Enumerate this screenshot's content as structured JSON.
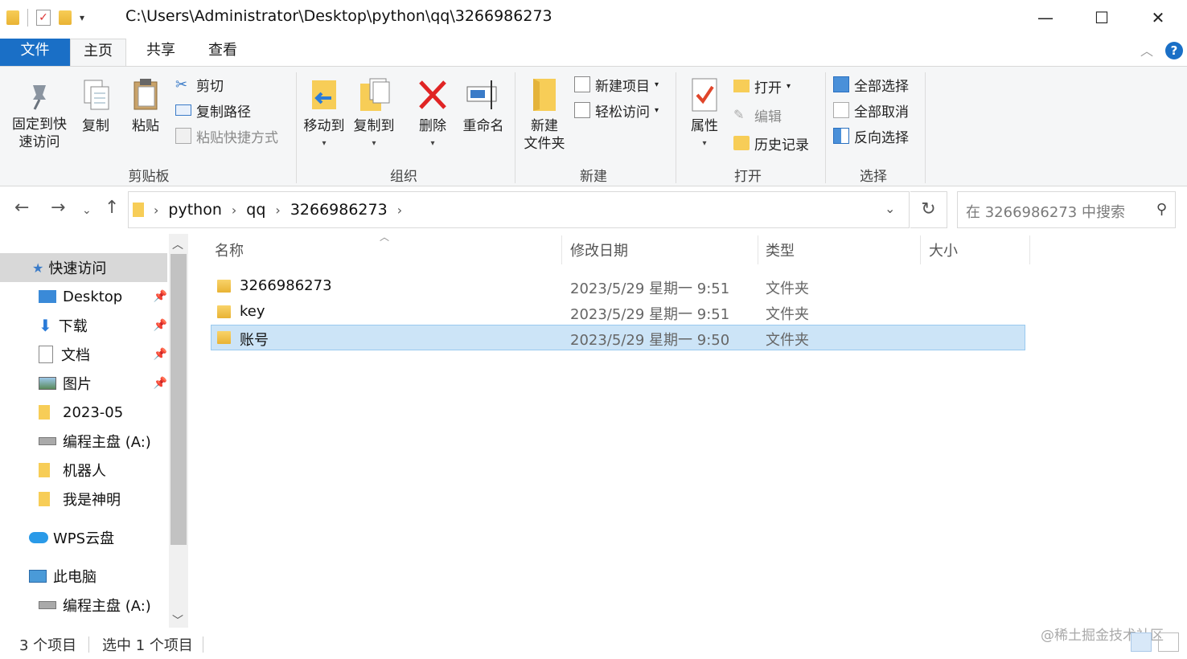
{
  "window": {
    "path": "C:\\Users\\Administrator\\Desktop\\python\\qq\\3266986273",
    "min": "—",
    "max": "☐",
    "close": "✕"
  },
  "tabs": {
    "file": "文件",
    "home": "主页",
    "share": "共享",
    "view": "查看"
  },
  "ribbon": {
    "clipboard": {
      "pin_l1": "固定到快",
      "pin_l2": "速访问",
      "copy": "复制",
      "paste": "粘贴",
      "cut": "剪切",
      "copy_path": "复制路径",
      "paste_shortcut": "粘贴快捷方式",
      "label": "剪贴板"
    },
    "organize": {
      "move_to": "移动到",
      "copy_to": "复制到",
      "delete": "删除",
      "rename": "重命名",
      "label": "组织"
    },
    "new": {
      "new_folder_l1": "新建",
      "new_folder_l2": "文件夹",
      "new_item": "新建项目",
      "easy_access": "轻松访问",
      "label": "新建"
    },
    "open": {
      "properties": "属性",
      "open": "打开",
      "edit": "编辑",
      "history": "历史记录",
      "label": "打开"
    },
    "select": {
      "select_all": "全部选择",
      "select_none": "全部取消",
      "invert": "反向选择",
      "label": "选择"
    }
  },
  "address": {
    "crumbs": [
      "python",
      "qq",
      "3266986273"
    ],
    "search_placeholder": "在 3266986273 中搜索"
  },
  "sidebar": {
    "quick_access": "快速访问",
    "items": [
      "Desktop",
      "下载",
      "文档",
      "图片",
      "2023-05",
      "编程主盘 (A:)",
      "机器人",
      "我是神明"
    ],
    "wps": "WPS云盘",
    "this_pc": "此电脑",
    "pc_drive": "编程主盘 (A:)"
  },
  "columns": {
    "name": "名称",
    "date": "修改日期",
    "type": "类型",
    "size": "大小"
  },
  "files": [
    {
      "name": "3266986273",
      "date": "2023/5/29 星期一 9:51",
      "type": "文件夹"
    },
    {
      "name": "key",
      "date": "2023/5/29 星期一 9:51",
      "type": "文件夹"
    },
    {
      "name": "账号",
      "date": "2023/5/29 星期一 9:50",
      "type": "文件夹"
    }
  ],
  "status": {
    "count": "3 个项目",
    "selected": "选中 1 个项目"
  },
  "watermark": "@稀土掘金技术社区"
}
